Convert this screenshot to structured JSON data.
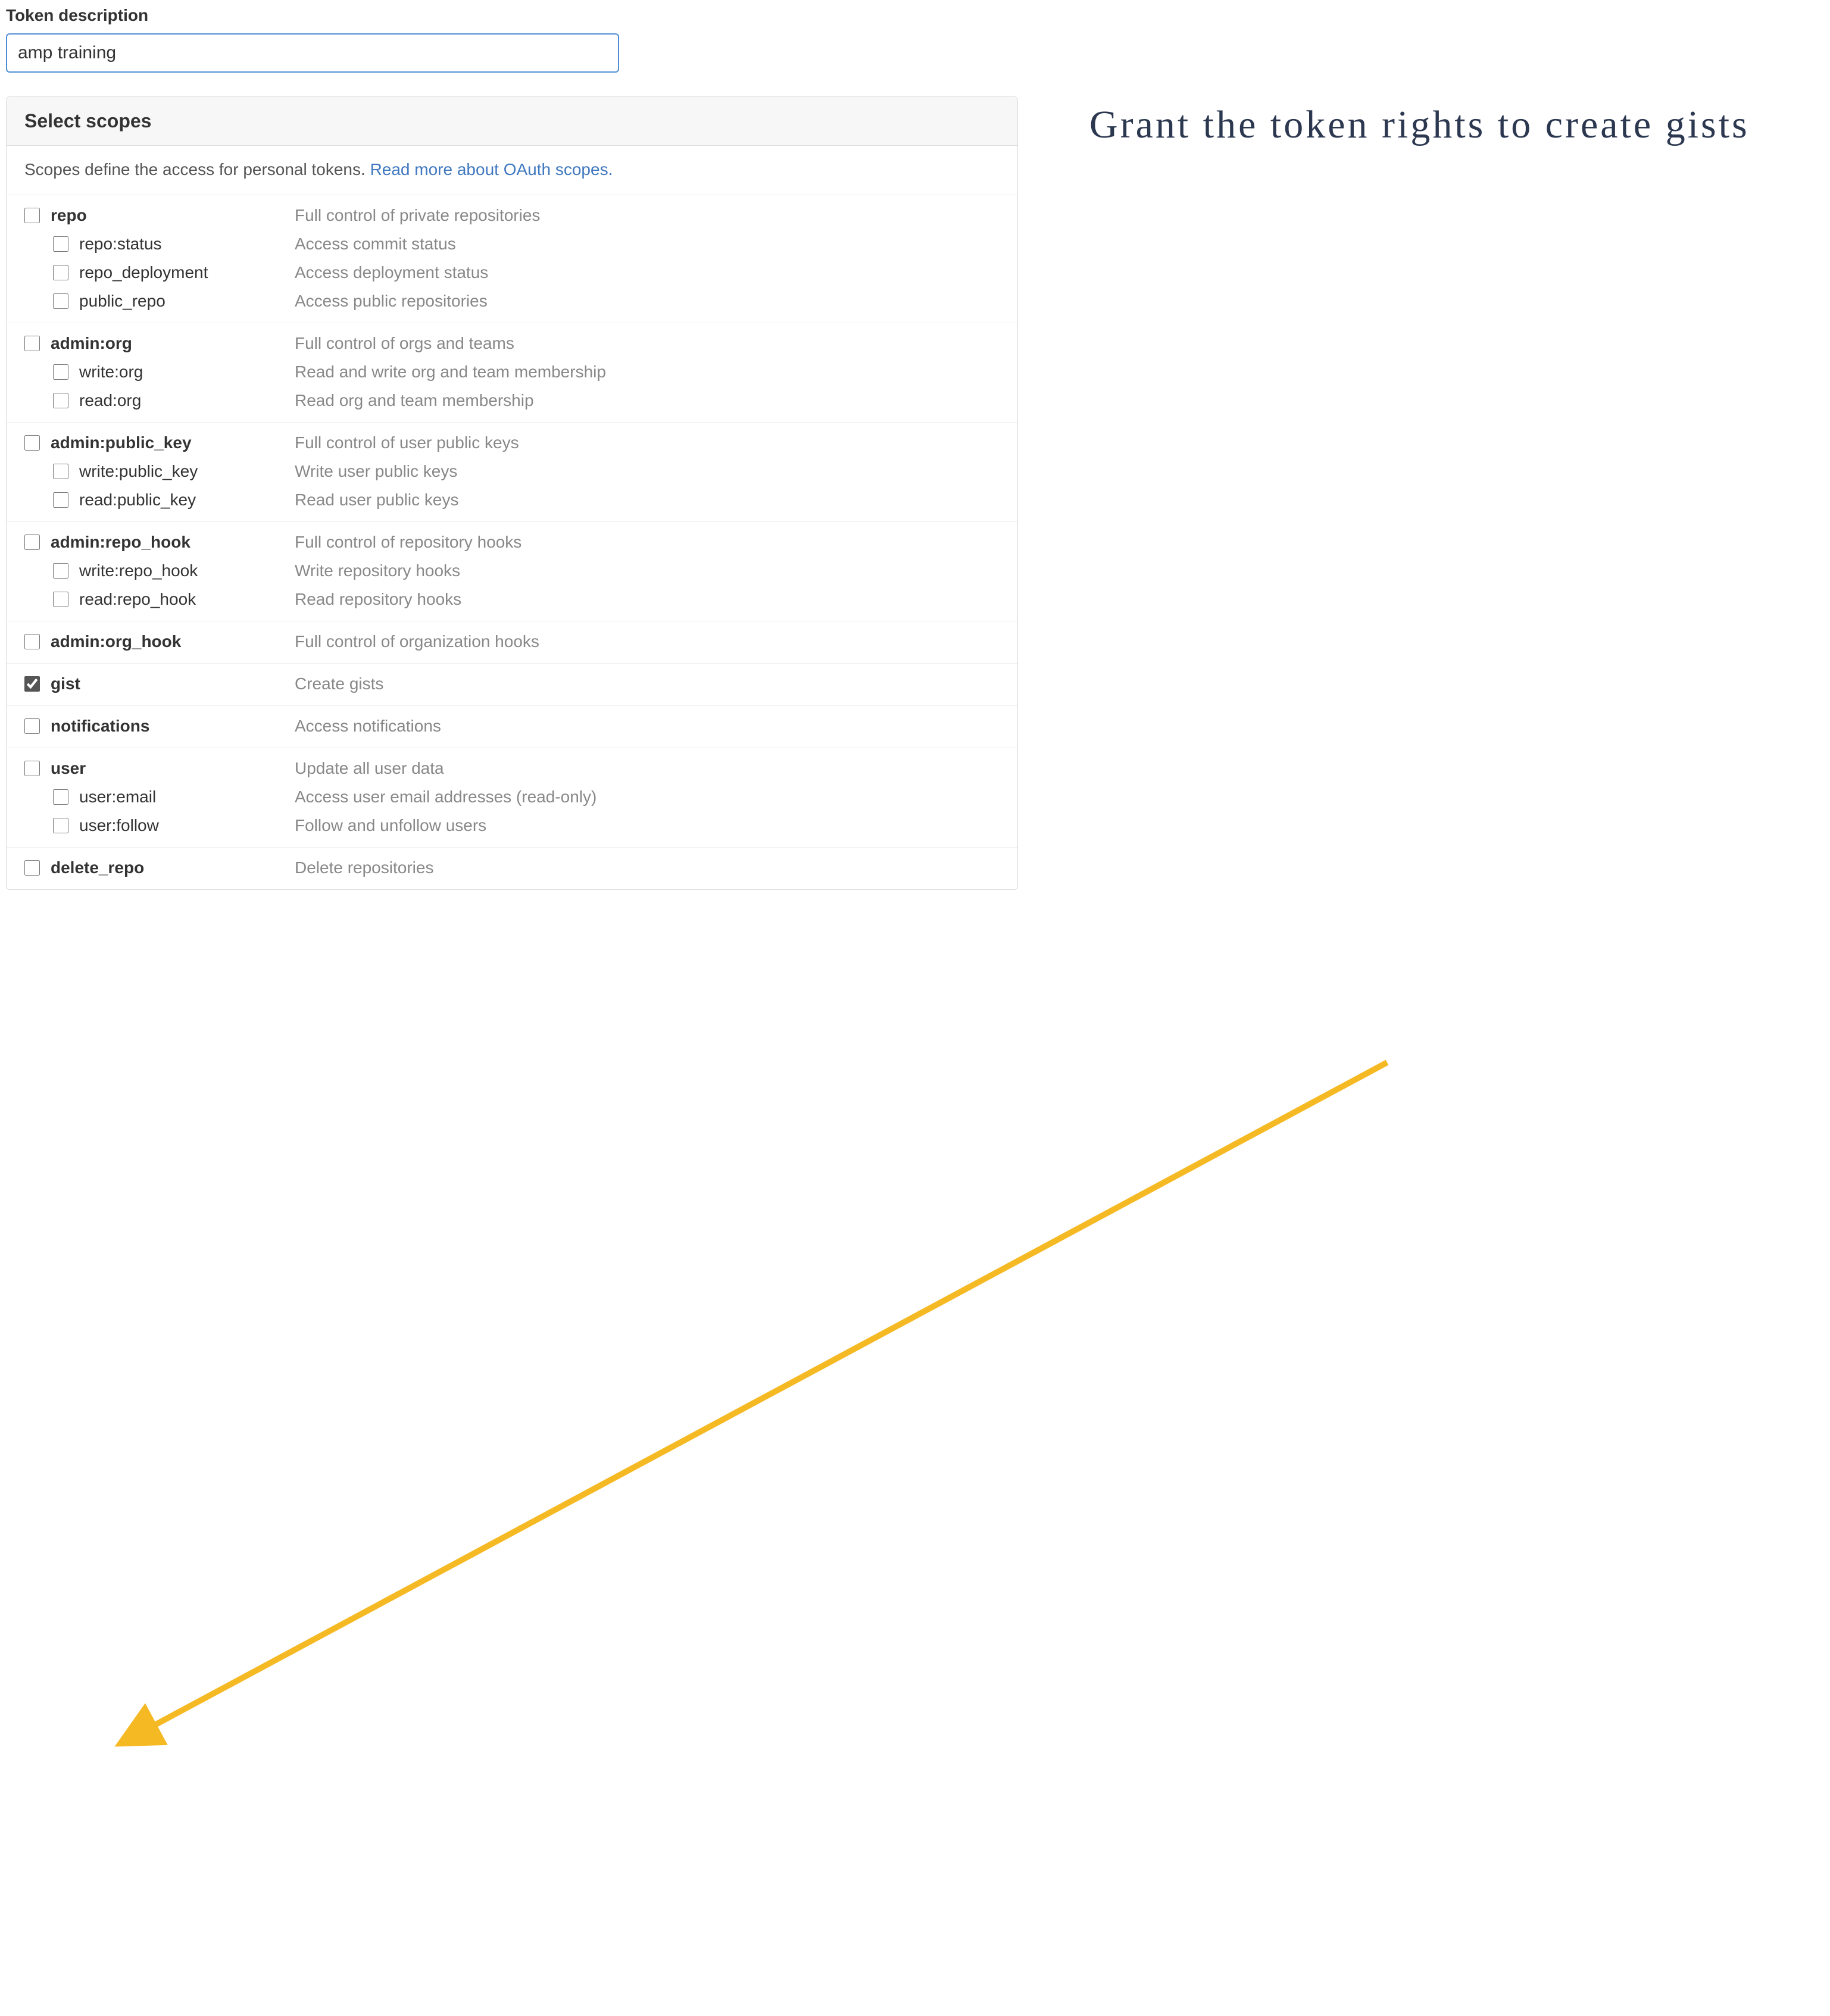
{
  "form": {
    "description_label": "Token description",
    "description_value": "amp training"
  },
  "panel": {
    "title": "Select scopes",
    "intro_text": "Scopes define the access for personal tokens. ",
    "intro_link": "Read more about OAuth scopes."
  },
  "scopes": [
    {
      "name": "repo",
      "desc": "Full control of private repositories",
      "checked": false,
      "children": [
        {
          "name": "repo:status",
          "desc": "Access commit status",
          "checked": false
        },
        {
          "name": "repo_deployment",
          "desc": "Access deployment status",
          "checked": false
        },
        {
          "name": "public_repo",
          "desc": "Access public repositories",
          "checked": false
        }
      ]
    },
    {
      "name": "admin:org",
      "desc": "Full control of orgs and teams",
      "checked": false,
      "children": [
        {
          "name": "write:org",
          "desc": "Read and write org and team membership",
          "checked": false
        },
        {
          "name": "read:org",
          "desc": "Read org and team membership",
          "checked": false
        }
      ]
    },
    {
      "name": "admin:public_key",
      "desc": "Full control of user public keys",
      "checked": false,
      "children": [
        {
          "name": "write:public_key",
          "desc": "Write user public keys",
          "checked": false
        },
        {
          "name": "read:public_key",
          "desc": "Read user public keys",
          "checked": false
        }
      ]
    },
    {
      "name": "admin:repo_hook",
      "desc": "Full control of repository hooks",
      "checked": false,
      "children": [
        {
          "name": "write:repo_hook",
          "desc": "Write repository hooks",
          "checked": false
        },
        {
          "name": "read:repo_hook",
          "desc": "Read repository hooks",
          "checked": false
        }
      ]
    },
    {
      "name": "admin:org_hook",
      "desc": "Full control of organization hooks",
      "checked": false,
      "children": []
    },
    {
      "name": "gist",
      "desc": "Create gists",
      "checked": true,
      "children": []
    },
    {
      "name": "notifications",
      "desc": "Access notifications",
      "checked": false,
      "children": []
    },
    {
      "name": "user",
      "desc": "Update all user data",
      "checked": false,
      "children": [
        {
          "name": "user:email",
          "desc": "Access user email addresses (read-only)",
          "checked": false
        },
        {
          "name": "user:follow",
          "desc": "Follow and unfollow users",
          "checked": false
        }
      ]
    },
    {
      "name": "delete_repo",
      "desc": "Delete repositories",
      "checked": false,
      "children": []
    }
  ],
  "annotation": {
    "text": "Grant the token rights to create gists"
  },
  "arrow": {
    "color": "#f5b924"
  }
}
